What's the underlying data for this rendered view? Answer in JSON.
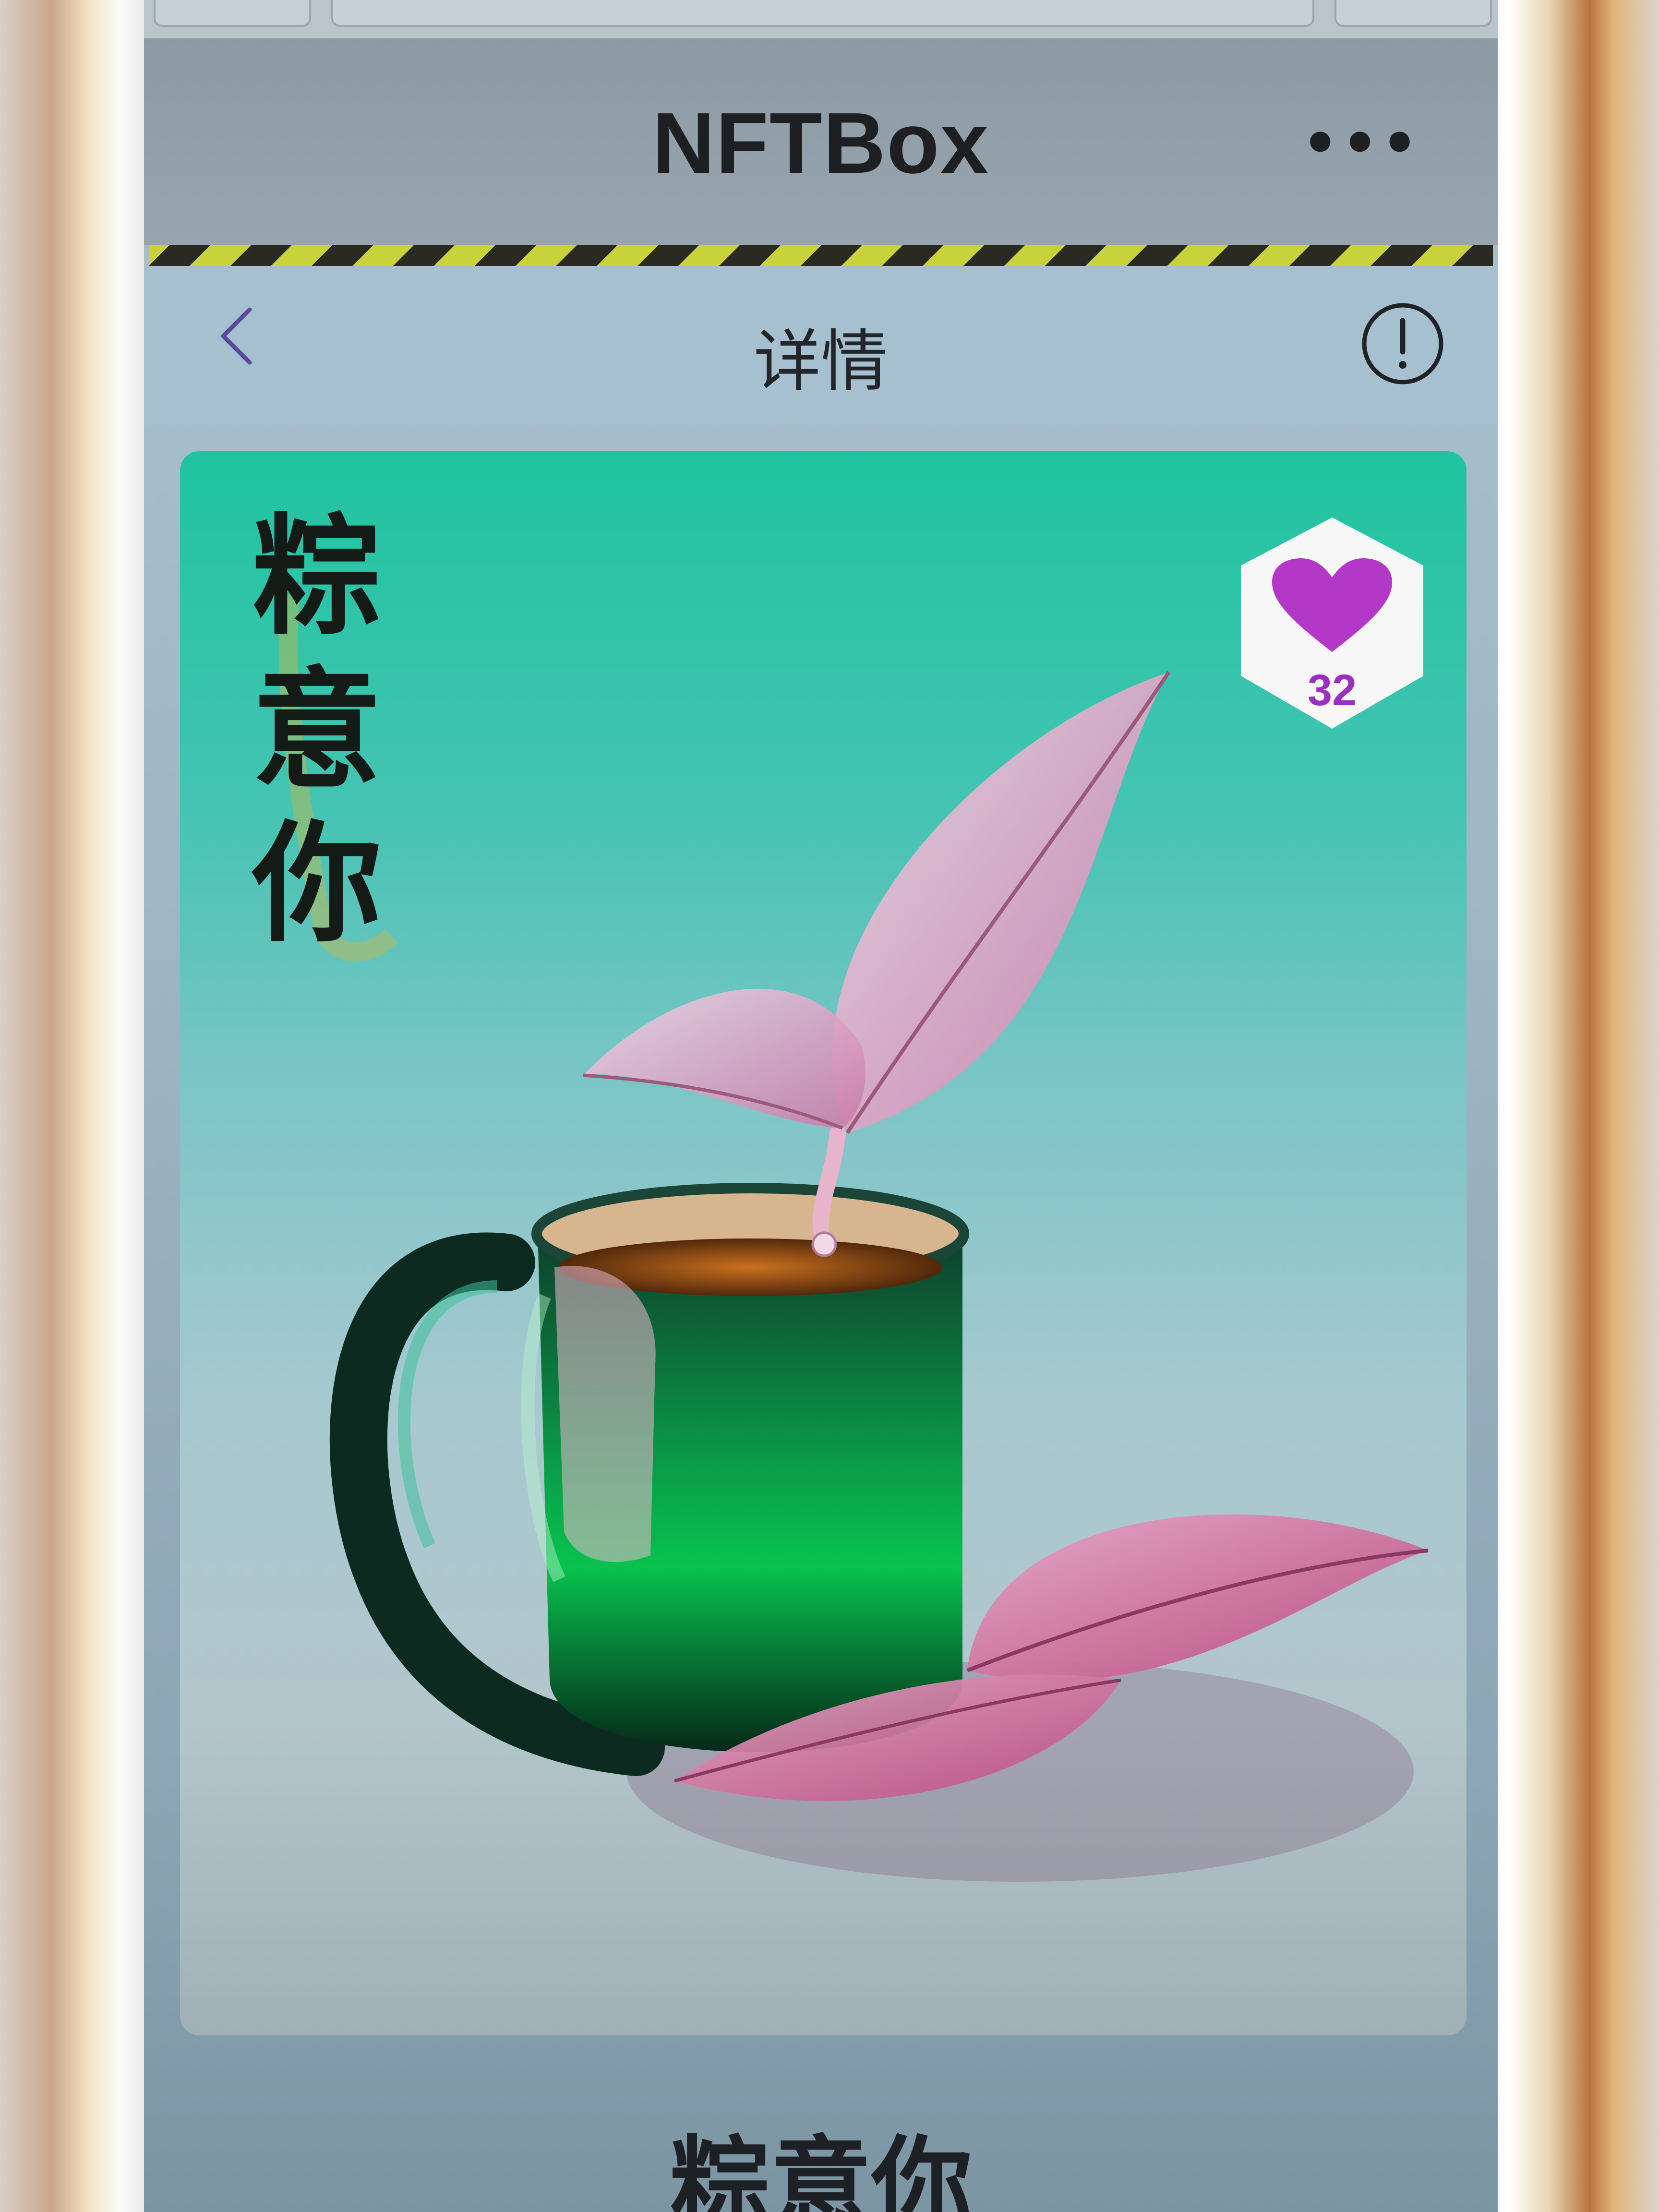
{
  "app": {
    "title": "NFTBox",
    "more_icon": "more-dots-icon"
  },
  "nav": {
    "title": "详情",
    "back_icon": "chevron-left-icon",
    "info_icon": "info-circle-icon"
  },
  "artwork": {
    "calligraphy": "粽\n意\n你",
    "like_icon": "heart-icon",
    "like_count": "32"
  },
  "item": {
    "name": "粽意你"
  },
  "colors": {
    "accent_purple": "#9b2fc4",
    "back_chevron": "#5a4a9c"
  }
}
